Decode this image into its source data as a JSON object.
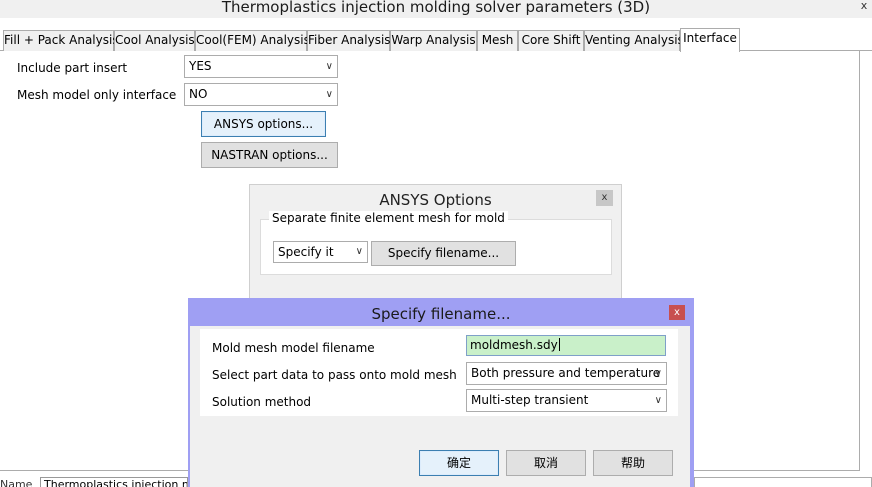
{
  "window": {
    "title": "Thermoplastics injection molding solver parameters (3D)",
    "close_glyph": "x"
  },
  "tabs": [
    {
      "label": "Fill + Pack Analysis"
    },
    {
      "label": "Cool Analysis"
    },
    {
      "label": "Cool(FEM) Analysis"
    },
    {
      "label": "Fiber Analysis"
    },
    {
      "label": "Warp Analysis"
    },
    {
      "label": "Mesh"
    },
    {
      "label": "Core Shift"
    },
    {
      "label": "Venting Analysis"
    },
    {
      "label": "Interface"
    }
  ],
  "interface_tab": {
    "include_part_insert": {
      "label": "Include part insert",
      "value": "YES"
    },
    "mesh_model_only": {
      "label": "Mesh model only interface",
      "value": "NO"
    },
    "ansys_button": "ANSYS options...",
    "nastran_button": "NASTRAN options..."
  },
  "ansys_dialog": {
    "title": "ANSYS Options",
    "close_glyph": "x",
    "group_label": "Separate finite element mesh for mold",
    "mode_value": "Specify it",
    "specify_button": "Specify filename..."
  },
  "filename_dialog": {
    "title": "Specify filename...",
    "close_glyph": "x",
    "fields": {
      "mold_mesh_filename": {
        "label": "Mold mesh model filename",
        "value": "moldmesh.sdy"
      },
      "part_data": {
        "label": "Select part data to pass onto mold mesh",
        "value": "Both pressure and temperature"
      },
      "solution_method": {
        "label": "Solution method",
        "value": "Multi-step transient"
      }
    },
    "buttons": {
      "ok": "确定",
      "cancel": "取消",
      "help": "帮助"
    }
  },
  "name_bar": {
    "label": "Name",
    "value": "Thermoplastics injection m"
  },
  "icons": {
    "dropdown": "chevron-down-icon",
    "close": "close-icon"
  },
  "colors": {
    "dialog_title_bar": "#9f9ff3",
    "close_button": "#c84f4f",
    "filename_input": "#c9f0c9"
  }
}
